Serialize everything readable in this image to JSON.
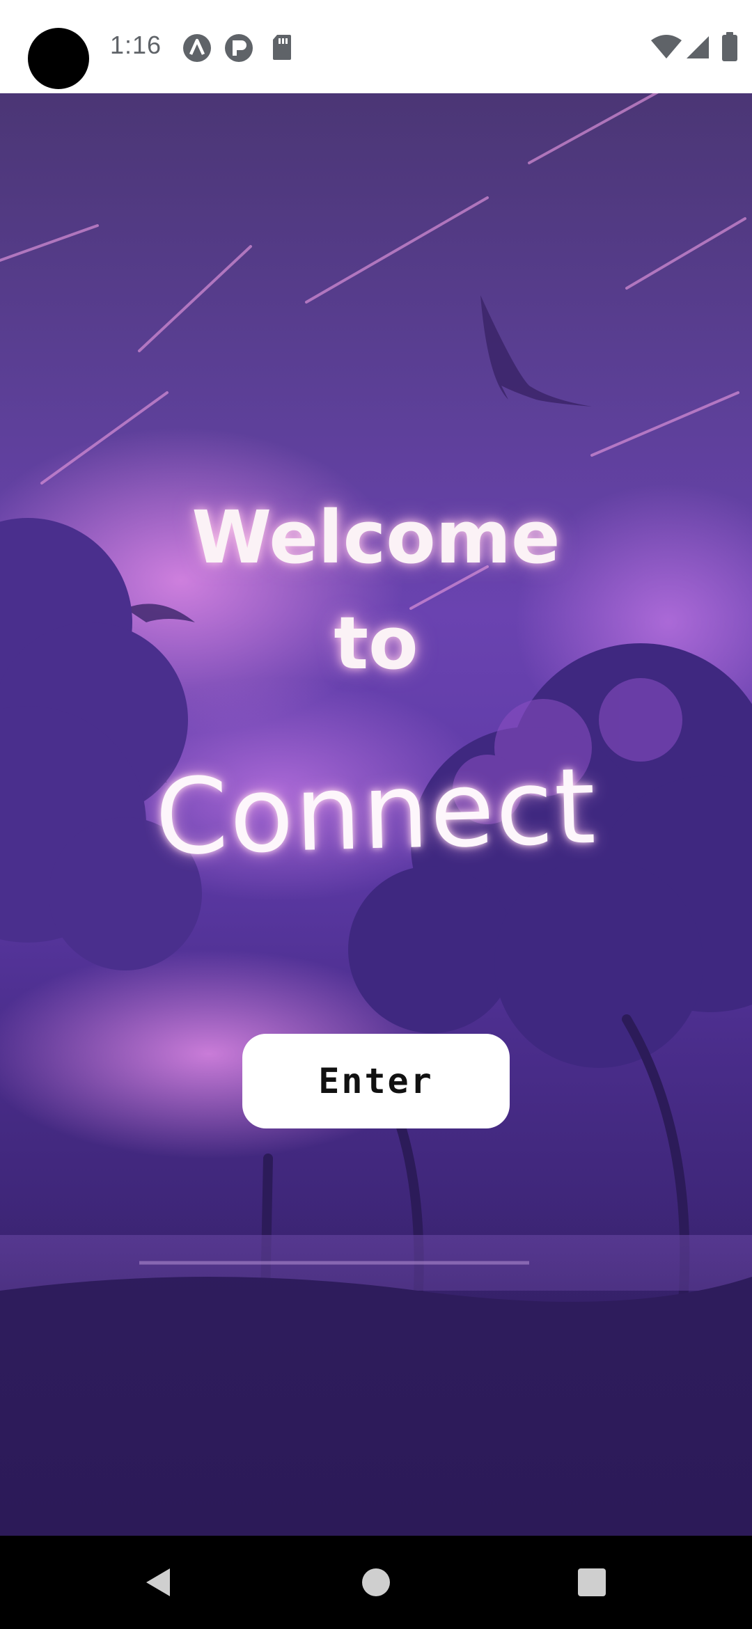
{
  "status_bar": {
    "time": "1:16",
    "left_icons": [
      "a-badge-icon",
      "p-badge-icon",
      "sd-card-icon"
    ],
    "right_icons": [
      "wifi-icon",
      "cell-signal-icon",
      "battery-icon"
    ],
    "icon_color": "#5f6368"
  },
  "main": {
    "title_line1": "Welcome",
    "title_line2": "to",
    "brand": "Connect",
    "enter_label": "Enter"
  },
  "nav_bar": {
    "buttons": [
      "back-icon",
      "home-icon",
      "recents-icon"
    ]
  },
  "colors": {
    "accent_purple": "#6a43b0",
    "dark_purple": "#2f1d5d",
    "button_bg": "#ffffff",
    "title_text": "#fbf2f6"
  }
}
